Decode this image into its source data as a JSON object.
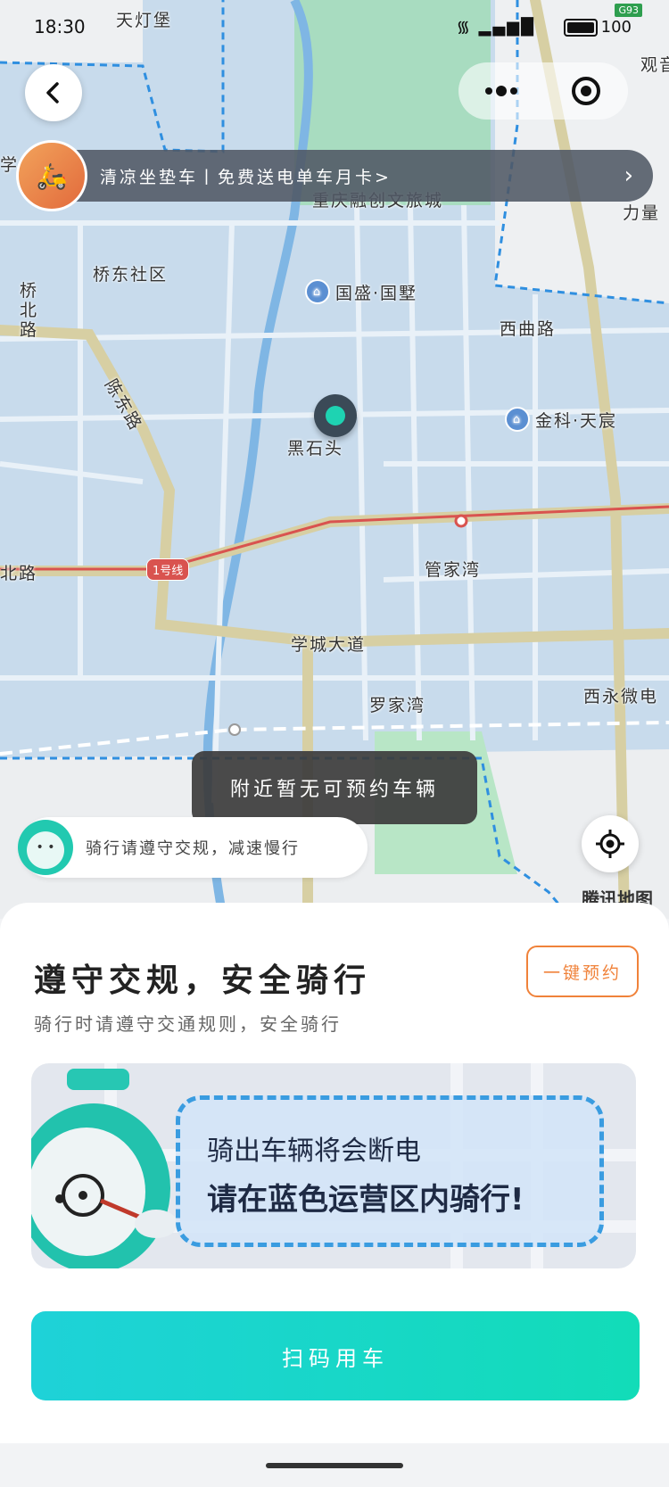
{
  "status_bar": {
    "time": "18:30",
    "battery": "100",
    "road_badge": "G93"
  },
  "map": {
    "labels": {
      "tiandengbao": "天灯堡",
      "qiaodong_community": "桥东社区",
      "qiaobei_road": "桥北路",
      "chendong_road": "陈东路",
      "guosheng": "国盛·国墅",
      "xishe_road": "西曲路",
      "jinke": "金科·天宸",
      "heishitou": "黑石头",
      "guanjiawan": "管家湾",
      "xuecheng_avenue": "学城大道",
      "luojiawan": "罗家湾",
      "xiyong": "西永微电",
      "line1": "1号线",
      "beilu": "北路",
      "chongqing_rongchuang": "重庆融创文旅城",
      "liliang": "力量",
      "guanjian": "观音",
      "tencent_map": "腾讯地图",
      "school": "学"
    }
  },
  "banner": {
    "text": "清凉坐垫车丨免费送电单车月卡>",
    "arrow": "›"
  },
  "toast": {
    "text": "附近暂无可预约车辆"
  },
  "hint": {
    "text": "骑行请遵守交规，减速慢行"
  },
  "panel": {
    "title": "遵守交规，安全骑行",
    "subtitle": "骑行时请遵守交通规则，安全骑行",
    "reserve_button": "一键预约",
    "card_line1": "骑出车辆将会断电",
    "card_line2": "请在蓝色运营区内骑行!",
    "scan_button": "扫码用车"
  }
}
